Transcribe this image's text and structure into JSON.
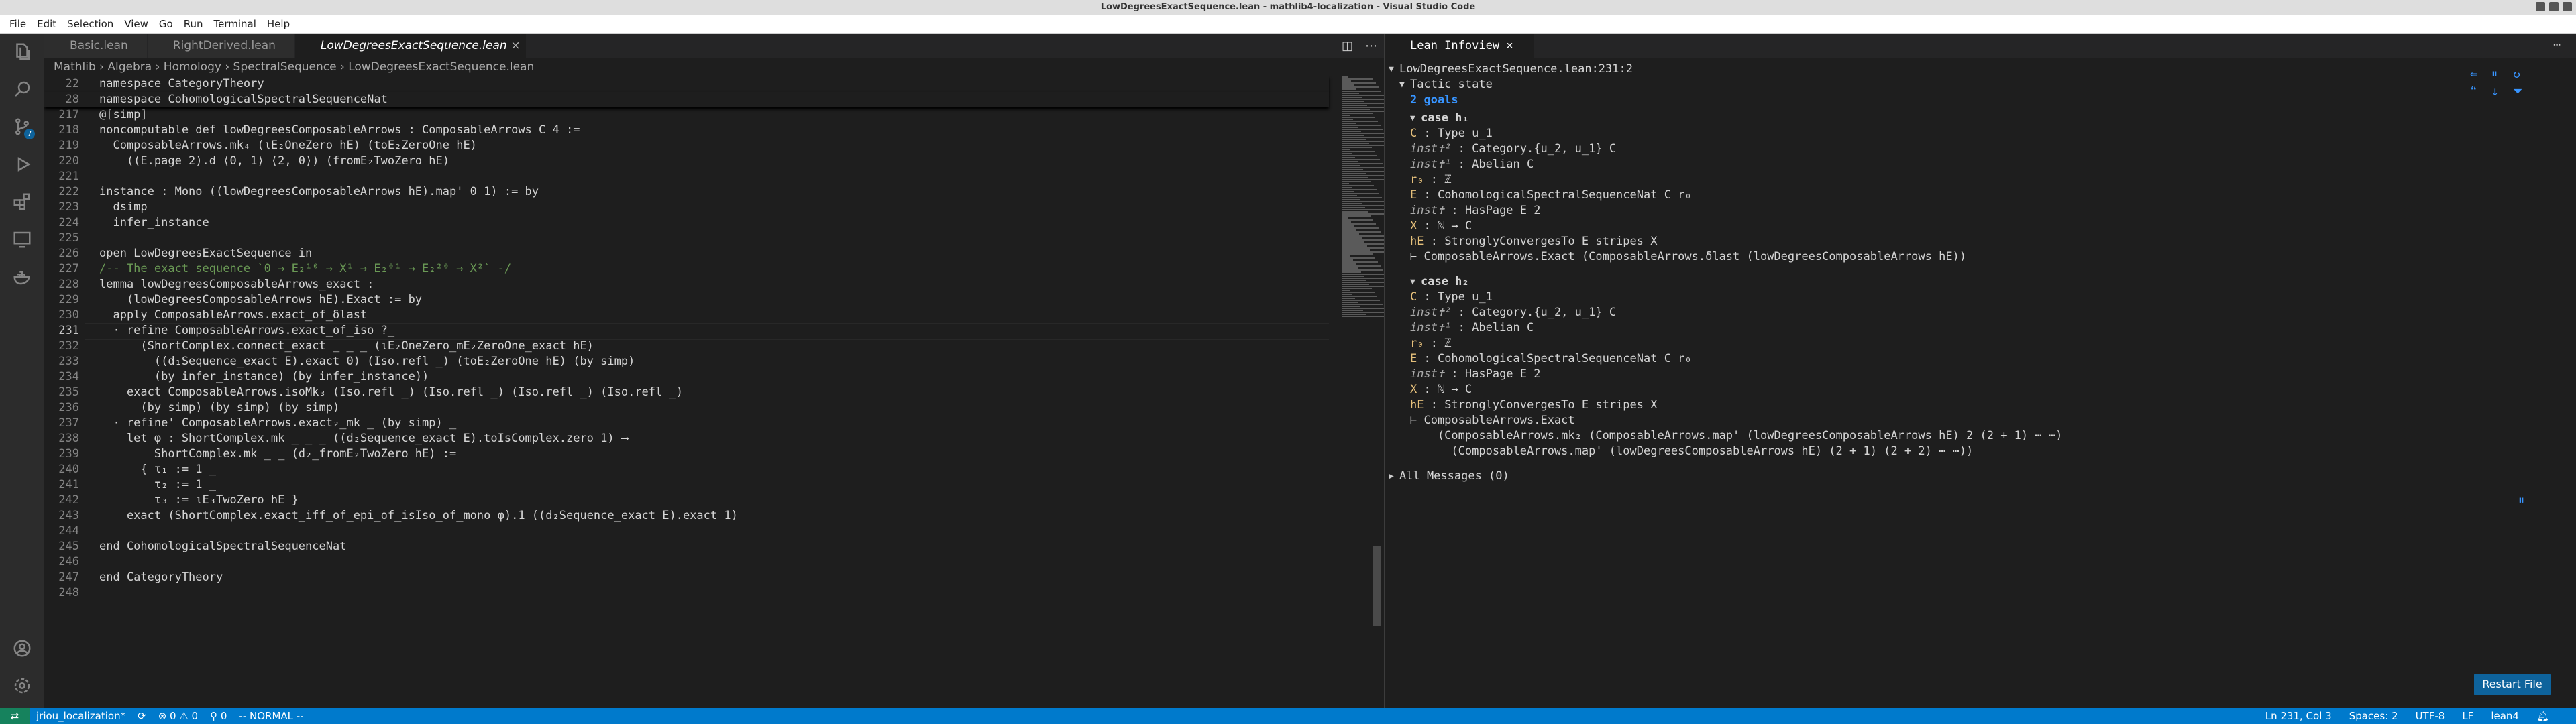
{
  "window": {
    "title": "LowDegreesExactSequence.lean - mathlib4-localization - Visual Studio Code"
  },
  "menu": [
    "File",
    "Edit",
    "Selection",
    "View",
    "Go",
    "Run",
    "Terminal",
    "Help"
  ],
  "activity": {
    "scm_badge": "7"
  },
  "tabs": [
    {
      "label": "Basic.lean"
    },
    {
      "label": "RightDerived.lean"
    },
    {
      "label": "LowDegreesExactSequence.lean"
    }
  ],
  "breadcrumb": [
    "Mathlib",
    "Algebra",
    "Homology",
    "SpectralSequence",
    "LowDegreesExactSequence.lean"
  ],
  "editor": {
    "sticky": [
      {
        "n": "22",
        "t": "namespace CategoryTheory"
      },
      {
        "n": "28",
        "t": "namespace CohomologicalSpectralSequenceNat"
      }
    ],
    "lines": [
      {
        "n": "217",
        "t": "@[simp]"
      },
      {
        "n": "218",
        "t": "noncomputable def lowDegreesComposableArrows : ComposableArrows C 4 :="
      },
      {
        "n": "219",
        "t": "  ComposableArrows.mk₄ (ιE₂OneZero hE) (toE₂ZeroOne hE)"
      },
      {
        "n": "220",
        "t": "    ((E.page 2).d ⟨0, 1⟩ ⟨2, 0⟩) (fromE₂TwoZero hE)"
      },
      {
        "n": "221",
        "t": ""
      },
      {
        "n": "222",
        "t": "instance : Mono ((lowDegreesComposableArrows hE).map' 0 1) := by"
      },
      {
        "n": "223",
        "t": "  dsimp"
      },
      {
        "n": "224",
        "t": "  infer_instance"
      },
      {
        "n": "225",
        "t": ""
      },
      {
        "n": "226",
        "t": "open LowDegreesExactSequence in"
      },
      {
        "n": "227",
        "t": "/-- The exact sequence `0 → E₂¹⁰ → X¹ → E₂⁰¹ → E₂²⁰ → X²` -/"
      },
      {
        "n": "228",
        "t": "lemma lowDegreesComposableArrows_exact :"
      },
      {
        "n": "229",
        "t": "    (lowDegreesComposableArrows hE).Exact := by"
      },
      {
        "n": "230",
        "t": "  apply ComposableArrows.exact_of_δlast"
      },
      {
        "n": "231",
        "t": "  · refine ComposableArrows.exact_of_iso ?_"
      },
      {
        "n": "232",
        "t": "      (ShortComplex.connect_exact _ _ _ (ιE₂OneZero_mE₂ZeroOne_exact hE)"
      },
      {
        "n": "233",
        "t": "        ((d₁Sequence_exact E).exact 0) (Iso.refl _) (toE₂ZeroOne hE) (by simp)"
      },
      {
        "n": "234",
        "t": "        (by infer_instance) (by infer_instance))"
      },
      {
        "n": "235",
        "t": "    exact ComposableArrows.isoMk₃ (Iso.refl _) (Iso.refl _) (Iso.refl _) (Iso.refl _)"
      },
      {
        "n": "236",
        "t": "      (by simp) (by simp) (by simp)"
      },
      {
        "n": "237",
        "t": "  · refine' ComposableArrows.exact₂_mk _ (by simp) _"
      },
      {
        "n": "238",
        "t": "    let φ : ShortComplex.mk _ _ _ ((d₂Sequence_exact E).toIsComplex.zero 1) ⟶"
      },
      {
        "n": "239",
        "t": "        ShortComplex.mk _ _ (d₂_fromE₂TwoZero hE) :="
      },
      {
        "n": "240",
        "t": "      { τ₁ := 1 _"
      },
      {
        "n": "241",
        "t": "        τ₂ := 1 _"
      },
      {
        "n": "242",
        "t": "        τ₃ := ιE₃TwoZero hE }"
      },
      {
        "n": "243",
        "t": "    exact (ShortComplex.exact_iff_of_epi_of_isIso_of_mono φ).1 ((d₂Sequence_exact E).exact 1)"
      },
      {
        "n": "244",
        "t": ""
      },
      {
        "n": "245",
        "t": "end CohomologicalSpectralSequenceNat"
      },
      {
        "n": "246",
        "t": ""
      },
      {
        "n": "247",
        "t": "end CategoryTheory"
      },
      {
        "n": "248",
        "t": ""
      }
    ]
  },
  "infoview": {
    "tab": "Lean Infoview",
    "location": "LowDegreesExactSequence.lean:231:2",
    "tactic_state": "Tactic state",
    "goals_count": "2 goals",
    "goal1": {
      "case": "case h₁",
      "hyps": [
        {
          "name": "C",
          "type": " : Type u_1"
        },
        {
          "name": "inst✝²",
          "type": " : Category.{u_2, u_1} C"
        },
        {
          "name": "inst✝¹",
          "type": " : Abelian C"
        },
        {
          "name": "r₀",
          "type": " : ℤ"
        },
        {
          "name": "E",
          "type": " : CohomologicalSpectralSequenceNat C r₀"
        },
        {
          "name": "inst✝",
          "type": " : HasPage E 2"
        },
        {
          "name": "X",
          "type": " : ℕ → C"
        },
        {
          "name": "hE",
          "type": " : StronglyConvergesTo E stripes X"
        }
      ],
      "goal": [
        "⊢ ComposableArrows.Exact (ComposableArrows.δlast (lowDegreesComposableArrows hE))"
      ]
    },
    "goal2": {
      "case": "case h₂",
      "hyps": [
        {
          "name": "C",
          "type": " : Type u_1"
        },
        {
          "name": "inst✝²",
          "type": " : Category.{u_2, u_1} C"
        },
        {
          "name": "inst✝¹",
          "type": " : Abelian C"
        },
        {
          "name": "r₀",
          "type": " : ℤ"
        },
        {
          "name": "E",
          "type": " : CohomologicalSpectralSequenceNat C r₀"
        },
        {
          "name": "inst✝",
          "type": " : HasPage E 2"
        },
        {
          "name": "X",
          "type": " : ℕ → C"
        },
        {
          "name": "hE",
          "type": " : StronglyConvergesTo E stripes X"
        }
      ],
      "goal": [
        "⊢ ComposableArrows.Exact",
        "    (ComposableArrows.mk₂ (ComposableArrows.map' (lowDegreesComposableArrows hE) 2 (2 + 1) ⋯ ⋯)",
        "      (ComposableArrows.map' (lowDegreesComposableArrows hE) (2 + 1) (2 + 2) ⋯ ⋯))"
      ]
    },
    "all_messages": "All Messages (0)",
    "restart": "Restart File"
  },
  "status": {
    "branch": "jriou_localization*",
    "problems": "⊗ 0 ⚠ 0",
    "ports": "⚲ 0",
    "mode": "-- NORMAL --",
    "position": "Ln 231, Col 3",
    "spaces": "Spaces: 2",
    "encoding": "UTF-8",
    "eol": "LF",
    "language": "lean4"
  }
}
